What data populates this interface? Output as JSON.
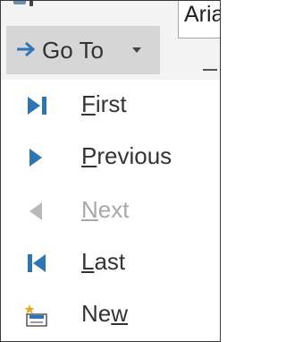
{
  "header": {
    "font_box_text": "Aria",
    "goto_label": "Go To"
  },
  "menu": {
    "items": [
      {
        "label": "First",
        "mnemonic": "F",
        "rest": "irst",
        "icon": "first-record-icon",
        "enabled": true
      },
      {
        "label": "Previous",
        "mnemonic": "P",
        "rest": "revious",
        "icon": "previous-record-icon",
        "enabled": true
      },
      {
        "label": "Next",
        "mnemonic": "N",
        "rest": "ext",
        "icon": "next-record-icon",
        "enabled": false
      },
      {
        "label": "Last",
        "mnemonic": "L",
        "rest": "ast",
        "icon": "last-record-icon",
        "enabled": true
      },
      {
        "label": "New",
        "mnemonic": "w",
        "prefix": "Ne",
        "icon": "new-record-icon",
        "enabled": true
      }
    ]
  },
  "colors": {
    "accent": "#2e75b6",
    "disabled": "#a8a8a8",
    "text": "#333333",
    "button_bg": "#d6d6d6"
  }
}
